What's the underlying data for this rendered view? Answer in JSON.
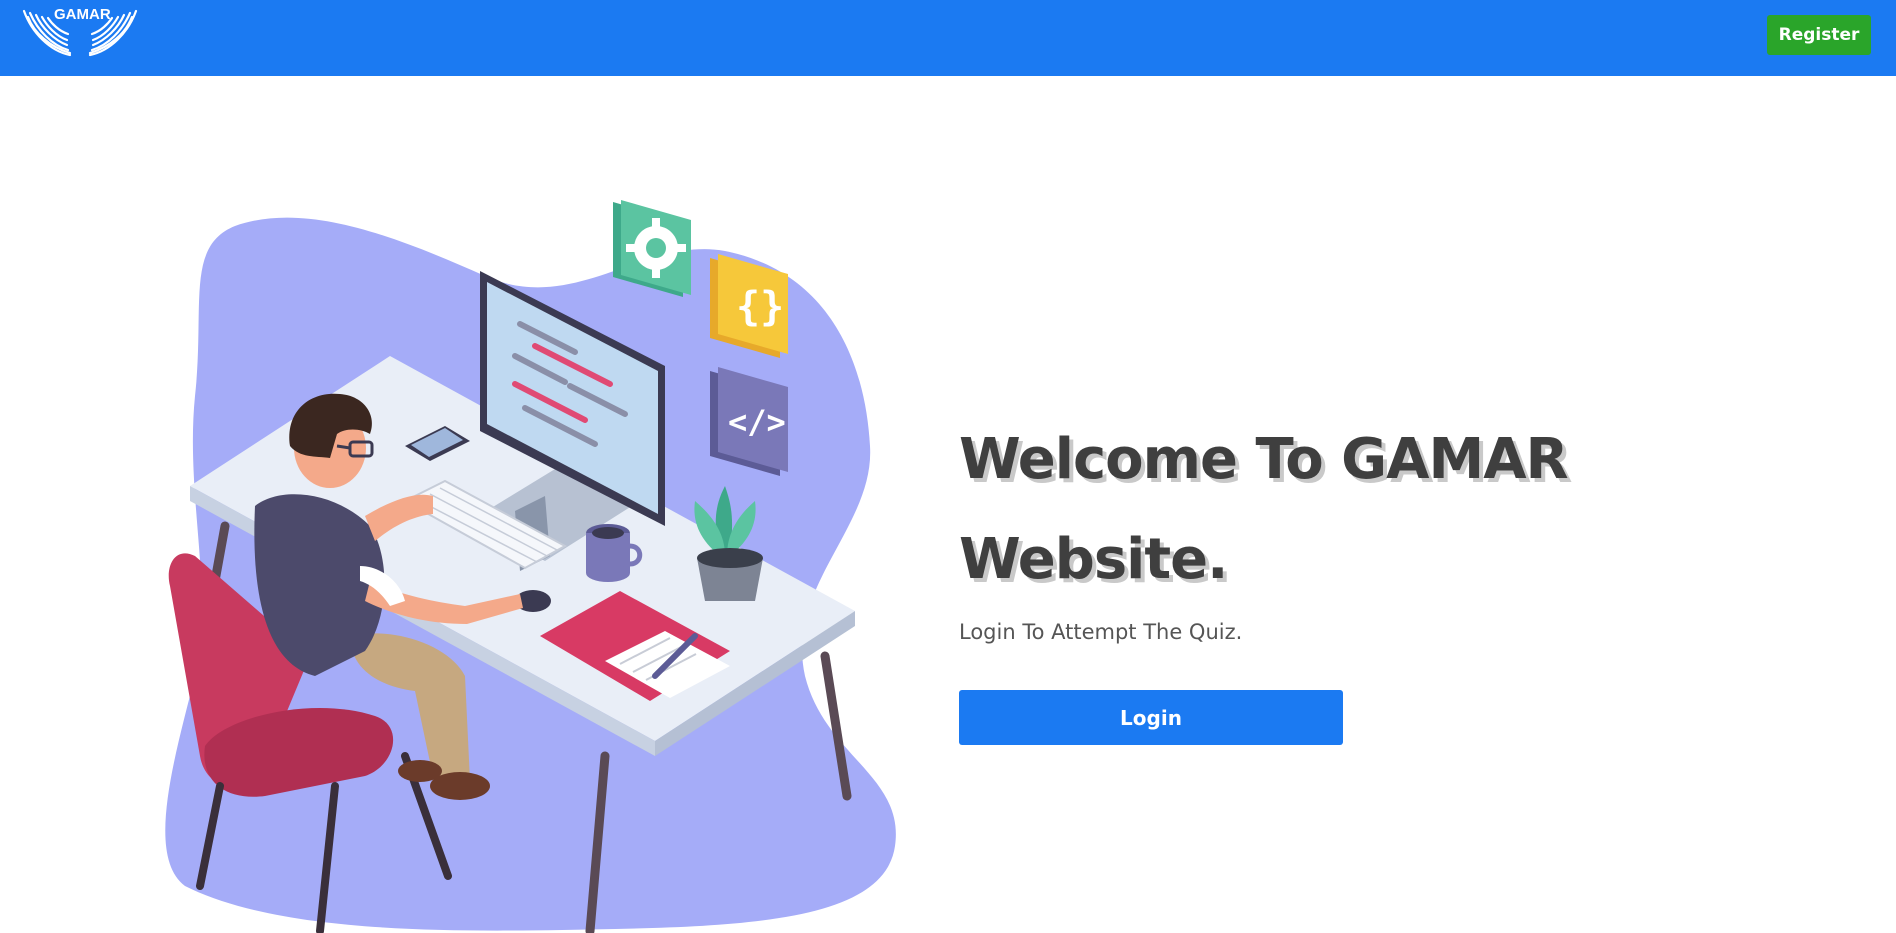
{
  "nav": {
    "logo_text": "GAMAR",
    "register_label": "Register"
  },
  "hero": {
    "title_line1": "Welcome To GAMAR",
    "title_line2": "Website.",
    "subtitle": "Login To Attempt The Quiz.",
    "login_label": "Login"
  },
  "colors": {
    "navbar": "#1b7af2",
    "register_button": "#2aa52a",
    "login_button": "#1b7af2",
    "blob": "#a5acf8",
    "chair": "#c83a5f"
  },
  "icons": {
    "gear": "gear-icon",
    "braces": "braces-icon",
    "code": "code-icon"
  }
}
